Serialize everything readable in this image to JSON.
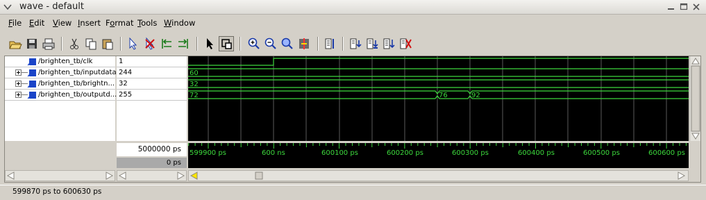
{
  "window": {
    "title": "wave - default"
  },
  "menu": [
    {
      "label": "File",
      "mnemonic": "F",
      "rest": "ile"
    },
    {
      "label": "Edit",
      "mnemonic": "E",
      "rest": "dit"
    },
    {
      "label": "View",
      "mnemonic": "V",
      "rest": "iew"
    },
    {
      "label": "Insert",
      "mnemonic": "I",
      "rest": "nsert"
    },
    {
      "label": "Format",
      "pre": "F",
      "mnemonic": "o",
      "rest": "rmat"
    },
    {
      "label": "Tools",
      "mnemonic": "T",
      "rest": "ools"
    },
    {
      "label": "Window",
      "mnemonic": "W",
      "rest": "indow"
    }
  ],
  "toolbar": {
    "buttons": [
      "open-icon",
      "save-icon",
      "print-icon",
      "cut-icon",
      "copy-icon",
      "paste-icon",
      "find-signal-icon",
      "delete-icon",
      "prev-edge-icon",
      "next-edge-icon",
      "select-pointer-icon",
      "zoom-mode-icon",
      "zoom-in-icon",
      "zoom-out-icon",
      "zoom-full-icon",
      "cursor-icon",
      "insert-divider-icon",
      "insert-signal-icon",
      "insert-breakpoint-icon",
      "insert-group-icon",
      "delete-cursor-icon"
    ]
  },
  "signals": [
    {
      "name": "/brighten_tb/clk",
      "value": "1",
      "expandable": false
    },
    {
      "name": "/brighten_tb/inputdata",
      "value": "244",
      "expandable": true
    },
    {
      "name": "/brighten_tb/brightn...",
      "value": "32",
      "expandable": true
    },
    {
      "name": "/brighten_tb/outputd...",
      "value": "255",
      "expandable": true
    }
  ],
  "waves": {
    "inputdata_label": "60",
    "brightness_label": "32",
    "output_labels": [
      "72",
      "76",
      "92"
    ]
  },
  "timeline": {
    "now": "5000000 ps",
    "cursor": "0 ps",
    "labels": [
      "599900 ps",
      "600 ns",
      "600100 ps",
      "600200 ps",
      "600300 ps",
      "600400 ps",
      "600500 ps",
      "600600 ps"
    ]
  },
  "status": {
    "range": "599870 ps to 600630 ps"
  },
  "colors": {
    "wave": "#3cd83c",
    "background": "#000000",
    "grid": "#5a5a5a",
    "cursor": "#ffff00"
  }
}
